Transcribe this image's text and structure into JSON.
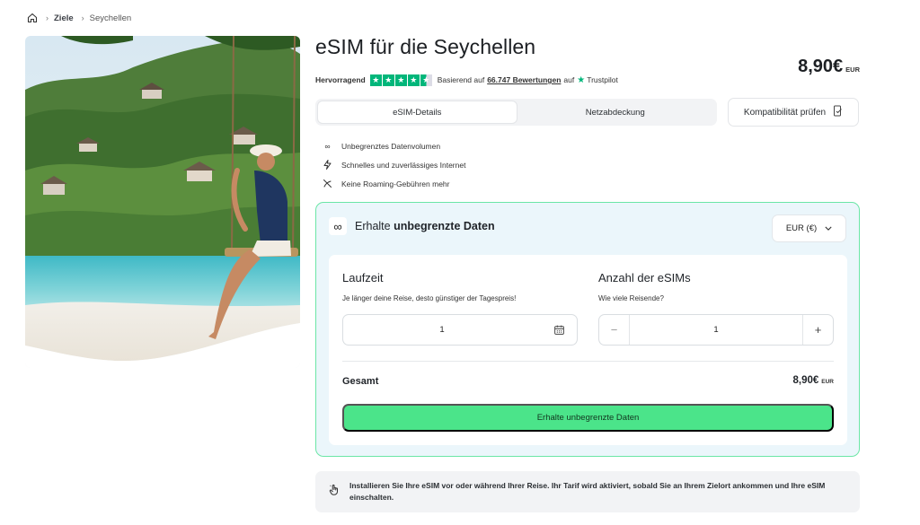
{
  "breadcrumb": {
    "items": [
      "Ziele",
      "Seychellen"
    ]
  },
  "hero": {
    "image_icon": "seychelles-swing-photo"
  },
  "product": {
    "title": "eSIM für die Seychellen",
    "price": "8,90€",
    "currency_label": "EUR"
  },
  "rating": {
    "label": "Hervorragend",
    "stars": 4.5,
    "based_on": "Basierend auf",
    "reviews": "66.747 Bewertungen",
    "on": "auf",
    "provider": "Trustpilot",
    "color": "#00b67a"
  },
  "tabs": [
    {
      "label": "eSIM-Details",
      "active": true
    },
    {
      "label": "Netzabdeckung",
      "active": false
    }
  ],
  "compat_button": {
    "label": "Kompatibilität prüfen",
    "icon": "phone-check-icon"
  },
  "features": [
    {
      "icon": "infinity-icon",
      "label": "Unbegrenztes Datenvolumen"
    },
    {
      "icon": "lightning-icon",
      "label": "Schnelles und zuverlässiges Internet"
    },
    {
      "icon": "no-roaming-icon",
      "label": "Keine Roaming-Gebühren mehr"
    }
  ],
  "panel": {
    "title_prefix": "Erhalte",
    "title_bold": "unbegrenzte Daten",
    "currency_select": "EUR (€)",
    "accent": "#4be48a",
    "duration": {
      "title": "Laufzeit",
      "subtitle": "Je länger deine Reise, desto günstiger der Tagespreis!",
      "value": "1"
    },
    "quantity": {
      "title": "Anzahl der eSIMs",
      "subtitle": "Wie viele Reisende?",
      "value": "1",
      "minus": "−",
      "plus": "+"
    },
    "total": {
      "label": "Gesamt",
      "amount": "8,90€",
      "currency": "EUR"
    },
    "cta": "Erhalte unbegrenzte Daten"
  },
  "info": {
    "text": "Installieren Sie Ihre eSIM vor oder während Ihrer Reise. Ihr Tarif wird aktiviert, sobald Sie an Ihrem Zielort ankommen und Ihre eSIM einschalten."
  }
}
